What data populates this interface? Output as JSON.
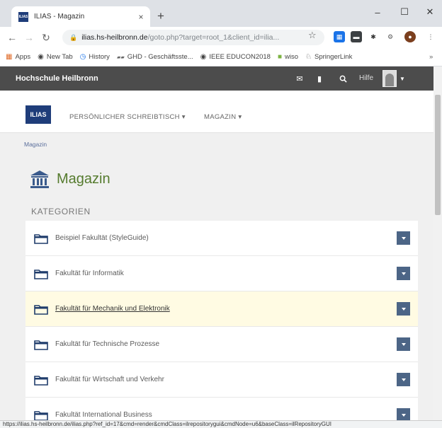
{
  "browser": {
    "tab_title": "ILIAS - Magazin",
    "tab_favicon_text": "ILIAS",
    "tab_close": "×",
    "new_tab": "+",
    "url_domain": "ilias.hs-heilbronn.de",
    "url_path": "/goto.php?target=root_1&client_id=ilia...",
    "window_controls": [
      "–",
      "☐",
      "✕"
    ],
    "bookmarks": [
      {
        "label": "Apps",
        "icon": "apps-icon"
      },
      {
        "label": "New Tab",
        "icon": "chrome-icon"
      },
      {
        "label": "History",
        "icon": "history-icon"
      },
      {
        "label": "GHD - Geschäftsste...",
        "icon": "ghd-icon"
      },
      {
        "label": "IEEE EDUCON2018",
        "icon": "chrome-icon"
      },
      {
        "label": "wiso",
        "icon": "wiso-icon"
      },
      {
        "label": "SpringerLink",
        "icon": "springer-icon"
      }
    ],
    "status_url": "https://ilias.hs-heilbronn.de/ilias.php?ref_id=17&cmd=render&cmdClass=ilrepositorygui&cmdNode=u6&baseClass=ilRepositoryGUI"
  },
  "ilias": {
    "site_title": "Hochschule Heilbronn",
    "help_label": "Hilfe",
    "logo_text": "ILIAS",
    "main_menu": [
      "PERSÖNLICHER SCHREIBTISCH ▾",
      "MAGAZIN ▾"
    ],
    "breadcrumb": "Magazin",
    "page_title": "Magazin",
    "section_title": "KATEGORIEN",
    "categories": [
      {
        "label": "Beispiel Fakultät (StyleGuide)",
        "highlight": false
      },
      {
        "label": "Fakultät für Informatik",
        "highlight": false
      },
      {
        "label": "Fakultät für Mechanik und Elektronik",
        "highlight": true
      },
      {
        "label": "Fakultät für Technische Prozesse",
        "highlight": false
      },
      {
        "label": "Fakultät für Wirtschaft und Verkehr",
        "highlight": false
      },
      {
        "label": "Fakultät International Business",
        "highlight": false
      }
    ],
    "colors": {
      "topbar": "#4c4c4c",
      "title_green": "#557b2e",
      "action_blue": "#4c6586",
      "highlight": "#fffbe3"
    }
  }
}
